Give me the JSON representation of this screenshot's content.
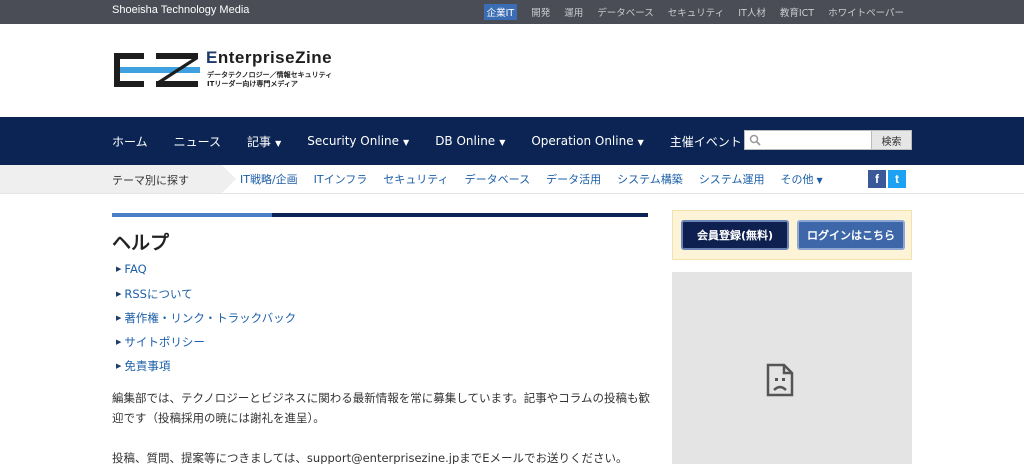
{
  "topbar": {
    "brand": "Shoeisha Technology Media",
    "sites": [
      "企業IT",
      "開発",
      "運用",
      "データベース",
      "セキュリティ",
      "IT人材",
      "教育ICT",
      "ホワイトペーパー"
    ]
  },
  "logo": {
    "title_first": "E",
    "title_rest": "nterpriseZine",
    "tagline1": "データテクノロジー／情報セキュリティ",
    "tagline2": "ITリーダー向け専門メディア"
  },
  "mainnav": {
    "items": [
      {
        "label": "ホーム",
        "caret": ""
      },
      {
        "label": "ニュース",
        "caret": ""
      },
      {
        "label": "記事",
        "caret": "▼"
      },
      {
        "label": "Security Online",
        "caret": "▼"
      },
      {
        "label": "DB Online",
        "caret": "▼"
      },
      {
        "label": "Operation Online",
        "caret": "▼"
      },
      {
        "label": "主催イベント",
        "caret": ""
      }
    ],
    "search_placeholder": "",
    "search_button": "検索"
  },
  "themebar": {
    "label": "テーマ別に探す",
    "links": [
      "IT戦略/企画",
      "ITインフラ",
      "セキュリティ",
      "データベース",
      "データ活用",
      "システム構築",
      "システム運用",
      "その他"
    ],
    "more_caret": "▼",
    "facebook": "f",
    "twitter": "t"
  },
  "main": {
    "title": "ヘルプ",
    "help_links": [
      "FAQ",
      "RSSについて",
      "著作権・リンク・トラックバック",
      "サイトポリシー",
      "免責事項"
    ],
    "paragraph1": "編集部では、テクノロジーとビジネスに関わる最新情報を常に募集しています。記事やコラムの投稿も歓迎です（投稿採用の暁には謝礼を進呈）。",
    "paragraph2": "投稿、質問、提案等につきましては、support@enterprisezine.jpまでEメールでお送りください。"
  },
  "sidebar": {
    "register_button": "会員登録(無料)",
    "login_button": "ログインはこちら"
  },
  "colors": {
    "topbar": "#4a4d56",
    "nav": "#0b2453",
    "link": "#1d5fa8",
    "accent_blue": "#4a7fc8"
  }
}
